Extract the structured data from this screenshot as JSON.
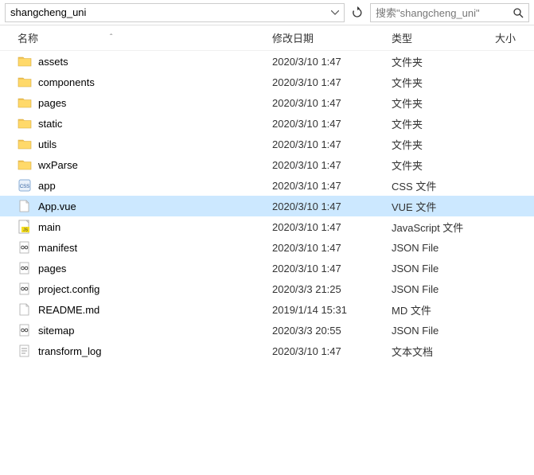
{
  "toolbar": {
    "path": "shangcheng_uni",
    "search_placeholder": "搜索\"shangcheng_uni\""
  },
  "headers": {
    "name": "名称",
    "date": "修改日期",
    "type": "类型",
    "size": "大小"
  },
  "rows": [
    {
      "icon": "folder",
      "name": "assets",
      "date": "2020/3/10 1:47",
      "type": "文件夹",
      "selected": false
    },
    {
      "icon": "folder",
      "name": "components",
      "date": "2020/3/10 1:47",
      "type": "文件夹",
      "selected": false
    },
    {
      "icon": "folder",
      "name": "pages",
      "date": "2020/3/10 1:47",
      "type": "文件夹",
      "selected": false
    },
    {
      "icon": "folder",
      "name": "static",
      "date": "2020/3/10 1:47",
      "type": "文件夹",
      "selected": false
    },
    {
      "icon": "folder",
      "name": "utils",
      "date": "2020/3/10 1:47",
      "type": "文件夹",
      "selected": false
    },
    {
      "icon": "folder",
      "name": "wxParse",
      "date": "2020/3/10 1:47",
      "type": "文件夹",
      "selected": false
    },
    {
      "icon": "css",
      "name": "app",
      "date": "2020/3/10 1:47",
      "type": "CSS 文件",
      "selected": false
    },
    {
      "icon": "file",
      "name": "App.vue",
      "date": "2020/3/10 1:47",
      "type": "VUE 文件",
      "selected": true
    },
    {
      "icon": "js",
      "name": "main",
      "date": "2020/3/10 1:47",
      "type": "JavaScript 文件",
      "selected": false
    },
    {
      "icon": "json",
      "name": "manifest",
      "date": "2020/3/10 1:47",
      "type": "JSON File",
      "selected": false
    },
    {
      "icon": "json",
      "name": "pages",
      "date": "2020/3/10 1:47",
      "type": "JSON File",
      "selected": false
    },
    {
      "icon": "json",
      "name": "project.config",
      "date": "2020/3/3 21:25",
      "type": "JSON File",
      "selected": false
    },
    {
      "icon": "file",
      "name": "README.md",
      "date": "2019/1/14 15:31",
      "type": "MD 文件",
      "selected": false
    },
    {
      "icon": "json",
      "name": "sitemap",
      "date": "2020/3/3 20:55",
      "type": "JSON File",
      "selected": false
    },
    {
      "icon": "text",
      "name": "transform_log",
      "date": "2020/3/10 1:47",
      "type": "文本文档",
      "selected": false
    }
  ]
}
